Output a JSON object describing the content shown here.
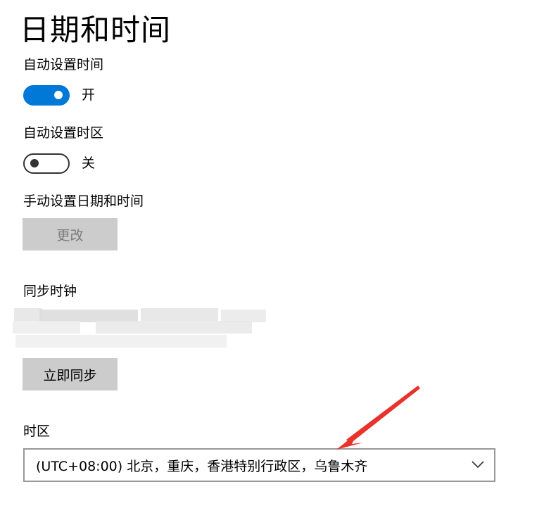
{
  "page": {
    "title": "日期和时间"
  },
  "auto_time": {
    "label": "自动设置时间",
    "state_label": "开",
    "enabled": true
  },
  "auto_timezone": {
    "label": "自动设置时区",
    "state_label": "关",
    "enabled": false
  },
  "manual": {
    "label": "手动设置日期和时间",
    "change_button": "更改"
  },
  "sync": {
    "label": "同步时钟",
    "sync_button": "立即同步"
  },
  "timezone": {
    "label": "时区",
    "selected": "(UTC+08:00) 北京，重庆，香港特别行政区，乌鲁木齐"
  },
  "colors": {
    "accent": "#0078d7",
    "button_bg": "#cccccc",
    "annotation_arrow": "#e8322b"
  },
  "icons": {
    "dropdown": "chevron-down-icon"
  }
}
